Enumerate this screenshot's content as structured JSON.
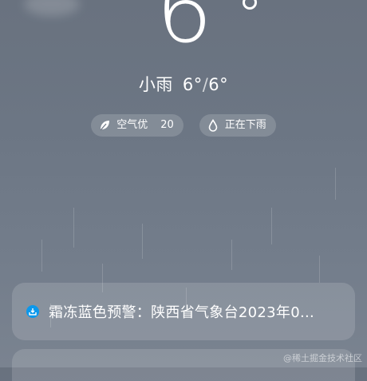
{
  "weather": {
    "current_temp": "6",
    "condition": "小雨",
    "temp_low": "6°",
    "temp_separator": "/",
    "temp_high": "6°"
  },
  "chips": [
    {
      "icon": "leaf-icon",
      "label": "空气优",
      "value": "20"
    },
    {
      "icon": "raindrop-icon",
      "label": "正在下雨"
    }
  ],
  "alert": {
    "icon": "warning-icon",
    "text": "霜冻蓝色预警：陕西省气象台2023年0...",
    "icon_color": "#0b98ec"
  },
  "watermark": "@稀土掘金技术社区"
}
